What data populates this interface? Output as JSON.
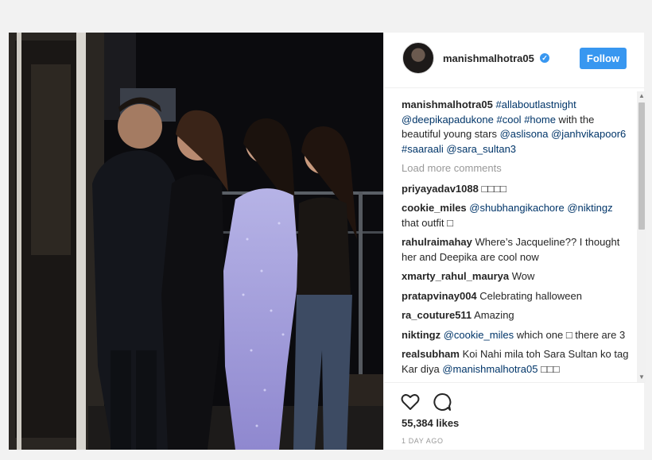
{
  "post": {
    "username": "manishmalhotra05",
    "follow_label": "Follow",
    "caption": {
      "user": "manishmalhotra05",
      "segments": [
        {
          "t": "#allaboutlastnight",
          "link": true
        },
        {
          "t": " ",
          "link": false
        },
        {
          "t": "@deepikapadukone",
          "link": true
        },
        {
          "t": " ",
          "link": false
        },
        {
          "t": "#cool",
          "link": true
        },
        {
          "t": " ",
          "link": false
        },
        {
          "t": "#home",
          "link": true
        },
        {
          "t": " with the beautiful young stars ",
          "link": false
        },
        {
          "t": "@aslisona",
          "link": true
        },
        {
          "t": " ",
          "link": false
        },
        {
          "t": "@janhvikapoor6",
          "link": true
        },
        {
          "t": " ",
          "link": false
        },
        {
          "t": "#saaraali",
          "link": true
        },
        {
          "t": " ",
          "link": false
        },
        {
          "t": "@sara_sultan3",
          "link": true
        }
      ]
    },
    "load_more": "Load more comments",
    "comments": [
      {
        "user": "priyayadav1088",
        "segments": [
          {
            "t": "□□□□",
            "link": false
          }
        ]
      },
      {
        "user": "cookie_miles",
        "segments": [
          {
            "t": "@shubhangikachore",
            "link": true
          },
          {
            "t": " ",
            "link": false
          },
          {
            "t": "@niktingz",
            "link": true
          },
          {
            "t": " that outfit □",
            "link": false
          }
        ]
      },
      {
        "user": "rahulraimahay",
        "segments": [
          {
            "t": "Where’s Jacqueline?? I thought her and Deepika are cool now",
            "link": false
          }
        ]
      },
      {
        "user": "xmarty_rahul_maurya",
        "segments": [
          {
            "t": "Wow",
            "link": false
          }
        ]
      },
      {
        "user": "pratapvinay004",
        "segments": [
          {
            "t": "Celebrating halloween",
            "link": false
          }
        ]
      },
      {
        "user": "ra_couture511",
        "segments": [
          {
            "t": "Amazing",
            "link": false
          }
        ]
      },
      {
        "user": "niktingz",
        "segments": [
          {
            "t": "@cookie_miles",
            "link": true
          },
          {
            "t": " which one □ there are 3",
            "link": false
          }
        ]
      },
      {
        "user": "realsubham",
        "segments": [
          {
            "t": "Koi Nahi mila toh Sara Sultan ko tag Kar diya ",
            "link": false
          },
          {
            "t": "@manishmalhotra05",
            "link": true
          },
          {
            "t": " □□□",
            "link": false
          }
        ]
      }
    ],
    "likes": "55,384 likes",
    "date": "1 DAY AGO",
    "colors": {
      "accent": "#3897f0",
      "link": "#003569",
      "text": "#262626",
      "muted": "#999999"
    },
    "icons": {
      "verified": "verified-badge-icon",
      "like": "heart-icon",
      "comment": "comment-bubble-icon"
    }
  }
}
